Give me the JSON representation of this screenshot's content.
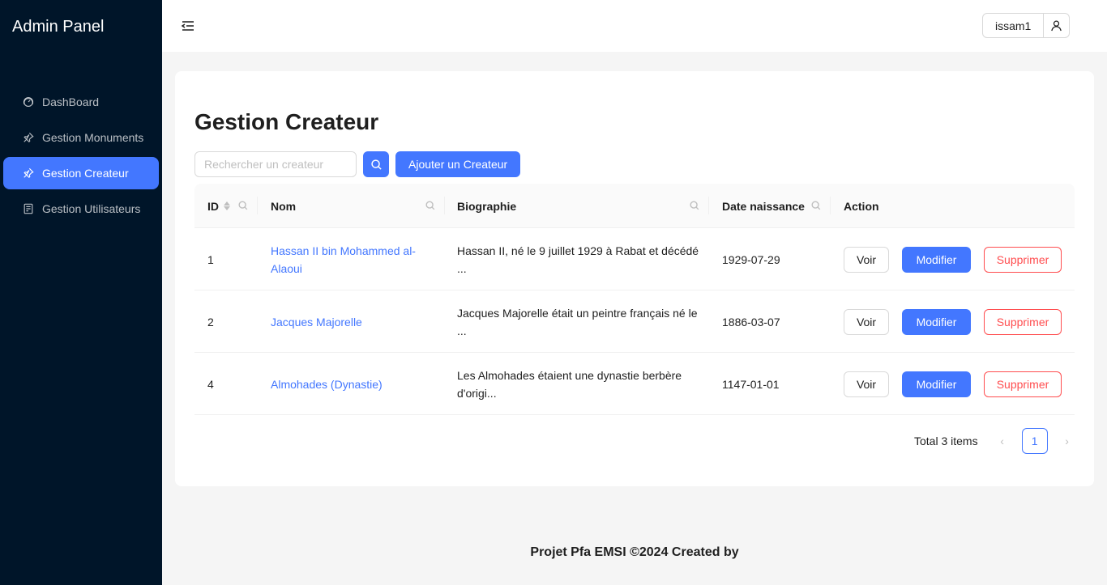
{
  "app": {
    "logo": "Admin Panel"
  },
  "sidebar": {
    "items": [
      {
        "label": "DashBoard",
        "icon": "dashboard-icon",
        "active": false
      },
      {
        "label": "Gestion Monuments",
        "icon": "pushpin-icon",
        "active": false
      },
      {
        "label": "Gestion Createur",
        "icon": "pushpin-icon",
        "active": true
      },
      {
        "label": "Gestion Utilisateurs",
        "icon": "reconciliation-icon",
        "active": false
      }
    ]
  },
  "header": {
    "username": "issam1",
    "user_icon": "user-icon",
    "collapse_icon": "menu-fold-icon"
  },
  "main": {
    "title": "Gestion Createur",
    "search": {
      "placeholder": "Rechercher un createur",
      "value": ""
    },
    "add_button": "Ajouter un Createur",
    "table": {
      "columns": [
        "ID",
        "Nom",
        "Biographie",
        "Date naissance",
        "Action"
      ],
      "rows": [
        {
          "id": "1",
          "nom": "Hassan II bin Mohammed al-Alaoui",
          "bio": "Hassan II, né le 9 juillet 1929 à Rabat et décédé ...",
          "date": "1929-07-29"
        },
        {
          "id": "2",
          "nom": "Jacques Majorelle",
          "bio": "Jacques Majorelle était un peintre français né le ...",
          "date": "1886-03-07"
        },
        {
          "id": "4",
          "nom": "Almohades (Dynastie)",
          "bio": "Les Almohades étaient une dynastie berbère d'origi...",
          "date": "1147-01-01"
        }
      ],
      "actions": {
        "view": "Voir",
        "edit": "Modifier",
        "delete": "Supprimer"
      }
    },
    "pagination": {
      "total": "Total 3 items",
      "current_page": "1",
      "prev": "‹",
      "next": "›"
    }
  },
  "footer": {
    "text": "Projet Pfa EMSI ©2024 Created by"
  },
  "colors": {
    "primary": "#4377ff",
    "sider": "#001529",
    "danger": "#ff4d4f"
  }
}
